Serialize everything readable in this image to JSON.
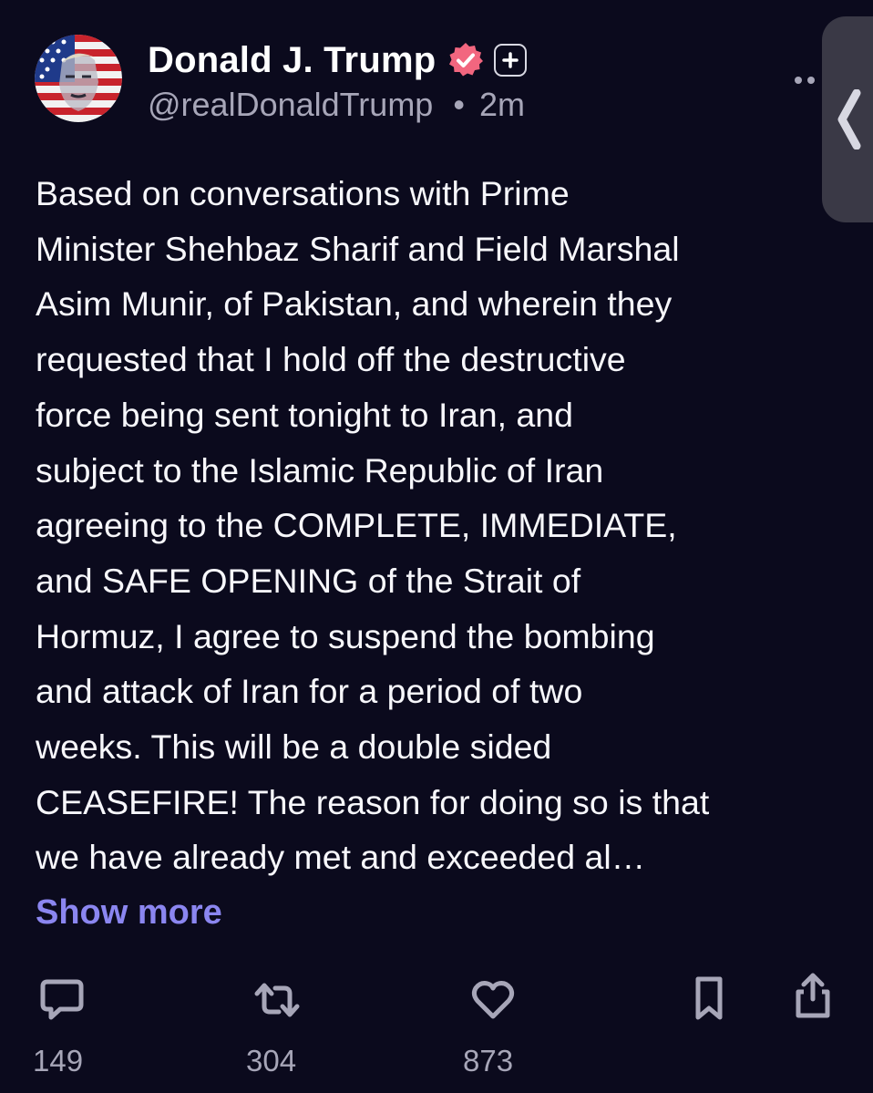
{
  "author": {
    "display_name": "Donald J. Trump",
    "handle": "@realDonaldTrump",
    "separator": "•",
    "time_ago": "2m",
    "avatar_icon": "flag-portrait-avatar",
    "verified_icon": "verified-badge-icon",
    "verified_color": "#f2667f",
    "plus_icon": "plus-badge-icon"
  },
  "post": {
    "text": "Based on conversations with Prime\nMinister Shehbaz Sharif and Field Marshal\nAsim Munir, of Pakistan, and wherein they\nrequested that I hold off the destructive\nforce being sent tonight to Iran, and\nsubject to the Islamic Republic of Iran\nagreeing to the COMPLETE, IMMEDIATE,\nand SAFE OPENING of the Strait of\nHormuz, I agree to suspend the bombing\nand attack of Iran for a period of two\nweeks. This will be a double sided\nCEASEFIRE! The reason for doing so is that\nwe have already met and exceeded al…",
    "show_more_label": "Show more",
    "show_more_color": "#8b86f0"
  },
  "actions": {
    "reply_count": "149",
    "repost_count": "304",
    "like_count": "873"
  },
  "colors": {
    "background": "#0b0a1d",
    "secondary_text": "#a7a6b8",
    "side_panel": "#3a3946"
  }
}
